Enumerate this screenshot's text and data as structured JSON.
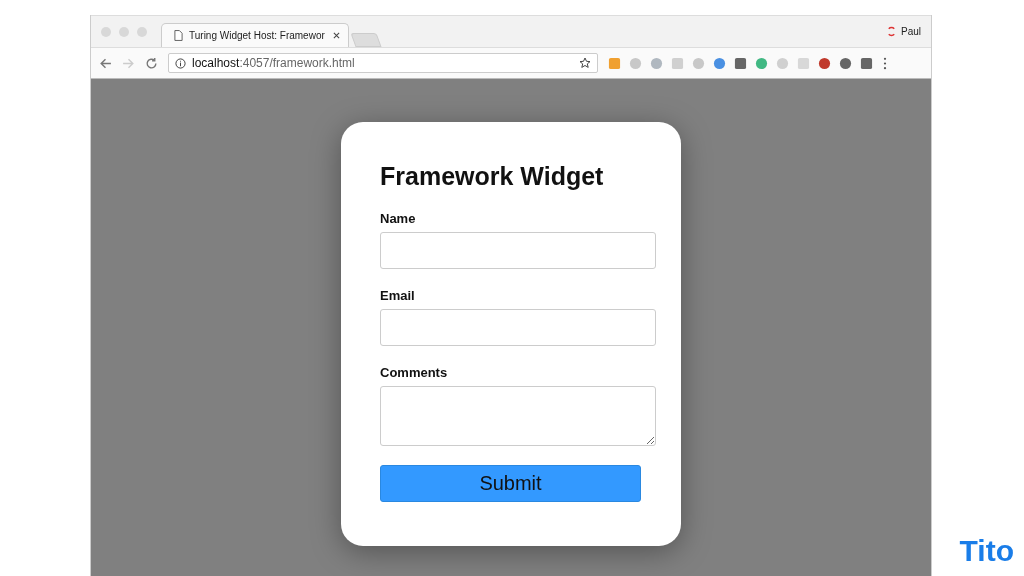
{
  "browser": {
    "tab": {
      "title": "Turing Widget Host: Framewor",
      "selected": true
    },
    "profile": "Paul",
    "url_host": "localhost",
    "url_path": ":4057/framework.html"
  },
  "widget": {
    "title": "Framework Widget",
    "fields": [
      {
        "label": "Name",
        "kind": "input"
      },
      {
        "label": "Email",
        "kind": "input"
      },
      {
        "label": "Comments",
        "kind": "textarea"
      }
    ],
    "submit": "Submit"
  },
  "logo": "Tito"
}
